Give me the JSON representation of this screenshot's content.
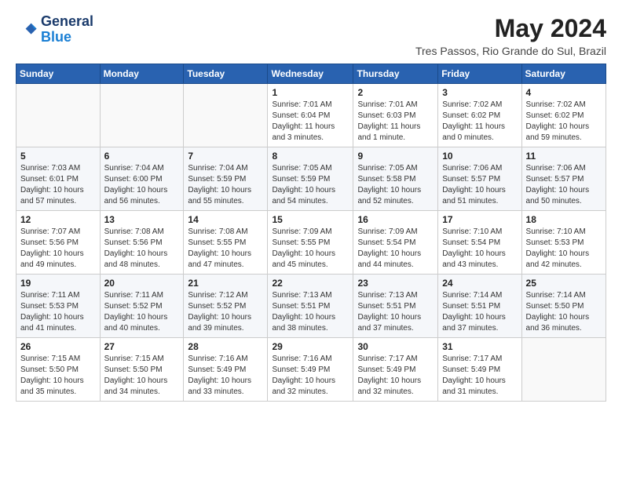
{
  "header": {
    "logo_line1": "General",
    "logo_line2": "Blue",
    "month_year": "May 2024",
    "location": "Tres Passos, Rio Grande do Sul, Brazil"
  },
  "days_of_week": [
    "Sunday",
    "Monday",
    "Tuesday",
    "Wednesday",
    "Thursday",
    "Friday",
    "Saturday"
  ],
  "weeks": [
    [
      {
        "day": "",
        "info": ""
      },
      {
        "day": "",
        "info": ""
      },
      {
        "day": "",
        "info": ""
      },
      {
        "day": "1",
        "info": "Sunrise: 7:01 AM\nSunset: 6:04 PM\nDaylight: 11 hours\nand 3 minutes."
      },
      {
        "day": "2",
        "info": "Sunrise: 7:01 AM\nSunset: 6:03 PM\nDaylight: 11 hours\nand 1 minute."
      },
      {
        "day": "3",
        "info": "Sunrise: 7:02 AM\nSunset: 6:02 PM\nDaylight: 11 hours\nand 0 minutes."
      },
      {
        "day": "4",
        "info": "Sunrise: 7:02 AM\nSunset: 6:02 PM\nDaylight: 10 hours\nand 59 minutes."
      }
    ],
    [
      {
        "day": "5",
        "info": "Sunrise: 7:03 AM\nSunset: 6:01 PM\nDaylight: 10 hours\nand 57 minutes."
      },
      {
        "day": "6",
        "info": "Sunrise: 7:04 AM\nSunset: 6:00 PM\nDaylight: 10 hours\nand 56 minutes."
      },
      {
        "day": "7",
        "info": "Sunrise: 7:04 AM\nSunset: 5:59 PM\nDaylight: 10 hours\nand 55 minutes."
      },
      {
        "day": "8",
        "info": "Sunrise: 7:05 AM\nSunset: 5:59 PM\nDaylight: 10 hours\nand 54 minutes."
      },
      {
        "day": "9",
        "info": "Sunrise: 7:05 AM\nSunset: 5:58 PM\nDaylight: 10 hours\nand 52 minutes."
      },
      {
        "day": "10",
        "info": "Sunrise: 7:06 AM\nSunset: 5:57 PM\nDaylight: 10 hours\nand 51 minutes."
      },
      {
        "day": "11",
        "info": "Sunrise: 7:06 AM\nSunset: 5:57 PM\nDaylight: 10 hours\nand 50 minutes."
      }
    ],
    [
      {
        "day": "12",
        "info": "Sunrise: 7:07 AM\nSunset: 5:56 PM\nDaylight: 10 hours\nand 49 minutes."
      },
      {
        "day": "13",
        "info": "Sunrise: 7:08 AM\nSunset: 5:56 PM\nDaylight: 10 hours\nand 48 minutes."
      },
      {
        "day": "14",
        "info": "Sunrise: 7:08 AM\nSunset: 5:55 PM\nDaylight: 10 hours\nand 47 minutes."
      },
      {
        "day": "15",
        "info": "Sunrise: 7:09 AM\nSunset: 5:55 PM\nDaylight: 10 hours\nand 45 minutes."
      },
      {
        "day": "16",
        "info": "Sunrise: 7:09 AM\nSunset: 5:54 PM\nDaylight: 10 hours\nand 44 minutes."
      },
      {
        "day": "17",
        "info": "Sunrise: 7:10 AM\nSunset: 5:54 PM\nDaylight: 10 hours\nand 43 minutes."
      },
      {
        "day": "18",
        "info": "Sunrise: 7:10 AM\nSunset: 5:53 PM\nDaylight: 10 hours\nand 42 minutes."
      }
    ],
    [
      {
        "day": "19",
        "info": "Sunrise: 7:11 AM\nSunset: 5:53 PM\nDaylight: 10 hours\nand 41 minutes."
      },
      {
        "day": "20",
        "info": "Sunrise: 7:11 AM\nSunset: 5:52 PM\nDaylight: 10 hours\nand 40 minutes."
      },
      {
        "day": "21",
        "info": "Sunrise: 7:12 AM\nSunset: 5:52 PM\nDaylight: 10 hours\nand 39 minutes."
      },
      {
        "day": "22",
        "info": "Sunrise: 7:13 AM\nSunset: 5:51 PM\nDaylight: 10 hours\nand 38 minutes."
      },
      {
        "day": "23",
        "info": "Sunrise: 7:13 AM\nSunset: 5:51 PM\nDaylight: 10 hours\nand 37 minutes."
      },
      {
        "day": "24",
        "info": "Sunrise: 7:14 AM\nSunset: 5:51 PM\nDaylight: 10 hours\nand 37 minutes."
      },
      {
        "day": "25",
        "info": "Sunrise: 7:14 AM\nSunset: 5:50 PM\nDaylight: 10 hours\nand 36 minutes."
      }
    ],
    [
      {
        "day": "26",
        "info": "Sunrise: 7:15 AM\nSunset: 5:50 PM\nDaylight: 10 hours\nand 35 minutes."
      },
      {
        "day": "27",
        "info": "Sunrise: 7:15 AM\nSunset: 5:50 PM\nDaylight: 10 hours\nand 34 minutes."
      },
      {
        "day": "28",
        "info": "Sunrise: 7:16 AM\nSunset: 5:49 PM\nDaylight: 10 hours\nand 33 minutes."
      },
      {
        "day": "29",
        "info": "Sunrise: 7:16 AM\nSunset: 5:49 PM\nDaylight: 10 hours\nand 32 minutes."
      },
      {
        "day": "30",
        "info": "Sunrise: 7:17 AM\nSunset: 5:49 PM\nDaylight: 10 hours\nand 32 minutes."
      },
      {
        "day": "31",
        "info": "Sunrise: 7:17 AM\nSunset: 5:49 PM\nDaylight: 10 hours\nand 31 minutes."
      },
      {
        "day": "",
        "info": ""
      }
    ]
  ]
}
